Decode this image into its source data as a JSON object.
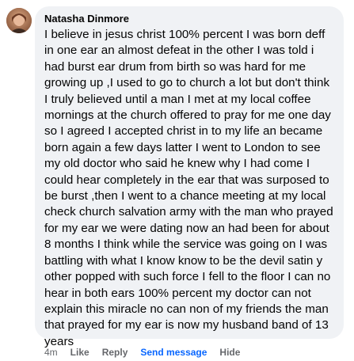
{
  "comment": {
    "author": "Natasha Dinmore",
    "text": "I believe in jesus christ 100% percent I was born deff in one ear an almost defeat in the other I was told i had burst ear drum from birth so was hard for me growing up ,I used to go to church a lot but don't think I truly believed until a man I met at my local coffee mornings at the church offered to pray for me one day so I agreed I accepted christ in to my life an became born again a few days latter I went to London to see my old doctor who said he knew why I had come I could hear completely in the ear that was surposed to be burst ,then I went to a chance meeting at my local check church salvation army with the man who prayed for my ear we were dating now an had been for about 8 months I think while the service was going on I was battling with what I know know to be the devil satin y other popped with such force I fell to the floor I can no hear in both ears 100% percent my doctor can not explain this miracle no can non of my friends the man that prayed for my ear is now my husband band of 13 years",
    "avatar_icon": "profile-photo"
  },
  "actions": {
    "timestamp": "4m",
    "like": "Like",
    "reply": "Reply",
    "send_message": "Send message",
    "hide": "Hide"
  },
  "colors": {
    "bubble_bg": "#f0f2f5",
    "text": "#050505",
    "secondary_text": "#65676b",
    "link": "#0866ff"
  }
}
